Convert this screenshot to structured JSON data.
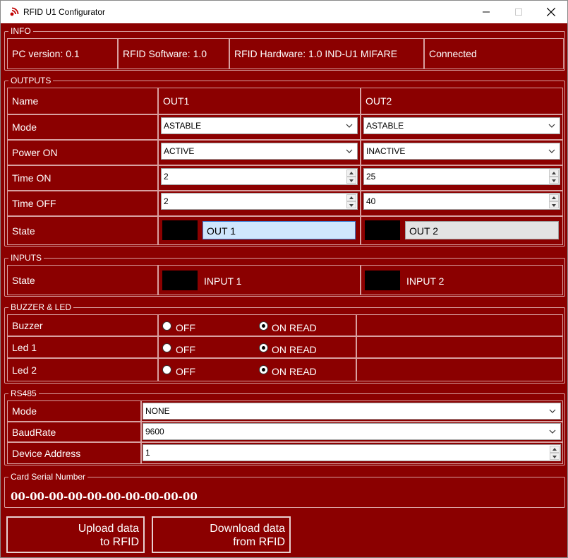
{
  "window": {
    "title": "RFID U1 Configurator"
  },
  "info": {
    "label": "INFO",
    "pc_version": "PC version: 0.1",
    "rfid_software": "RFID Software: 1.0",
    "rfid_hardware": "RFID Hardware: 1.0 IND-U1 MIFARE",
    "status": "Connected"
  },
  "outputs": {
    "label": "OUTPUTS",
    "row_labels": {
      "name": "Name",
      "mode": "Mode",
      "power_on": "Power ON",
      "time_on": "Time ON",
      "time_off": "Time OFF",
      "state": "State"
    },
    "out1": {
      "name": "OUT1",
      "mode": "ASTABLE",
      "power_on": "ACTIVE",
      "time_on": "2",
      "time_off": "2",
      "state_label": "OUT 1"
    },
    "out2": {
      "name": "OUT2",
      "mode": "ASTABLE",
      "power_on": "INACTIVE",
      "time_on": "25",
      "time_off": "40",
      "state_label": "OUT 2"
    }
  },
  "inputs": {
    "label": "INPUTS",
    "state_label": "State",
    "input1": "INPUT 1",
    "input2": "INPUT 2"
  },
  "buzzer_led": {
    "label": "BUZZER & LED",
    "off_label": "OFF",
    "on_read_label": "ON READ",
    "rows": [
      {
        "name": "Buzzer",
        "selected": "on_read"
      },
      {
        "name": "Led 1",
        "selected": "on_read"
      },
      {
        "name": "Led 2",
        "selected": "on_read"
      }
    ]
  },
  "rs485": {
    "label": "RS485",
    "mode_label": "Mode",
    "mode": "NONE",
    "baudrate_label": "BaudRate",
    "baudrate": "9600",
    "device_address_label": "Device Address",
    "device_address": "1"
  },
  "card": {
    "label": "Card Serial Number",
    "serial": "00-00-00-00-00-00-00-00-00-00"
  },
  "buttons": {
    "upload_line1": "Upload data",
    "upload_line2": "to RFID",
    "download_line1": "Download data",
    "download_line2": "from RFID"
  },
  "colors": {
    "background": "#8b0000",
    "border": "#d8a0a0",
    "selected_field": "#cfe6fd",
    "disabled_field": "#e3e3e3"
  }
}
